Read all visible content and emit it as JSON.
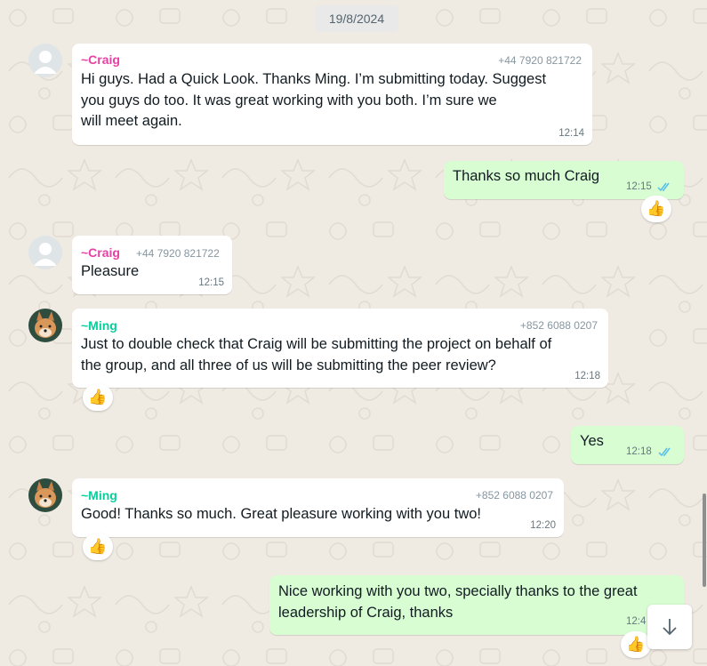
{
  "date_chip": "19/8/2024",
  "colors": {
    "craig_name": "#e542a3",
    "ming_name": "#06cf9c",
    "outgoing_bubble": "#d9fdd3",
    "incoming_bubble": "#ffffff",
    "read_ticks": "#53bdeb"
  },
  "messages": [
    {
      "sender": "~Craig",
      "phone": "+44 7920 821722",
      "text_lines": [
        "Hi guys. Had a Quick Look. Thanks Ming. I’m submitting today. Suggest",
        "you guys do too. It was great working with you both. I’m sure we",
        "will meet again."
      ],
      "time": "12:14"
    },
    {
      "text": "Thanks so much Craig",
      "time": "12:15",
      "reaction": "👍"
    },
    {
      "sender": "~Craig",
      "phone": "+44 7920 821722",
      "text": "Pleasure",
      "time": "12:15"
    },
    {
      "sender": "~Ming",
      "phone": "+852 6088 0207",
      "text_lines": [
        "Just to double check that Craig will be submitting the project on behalf of",
        "the group, and all three of us will be submitting the peer review?"
      ],
      "time": "12:18",
      "reaction": "👍"
    },
    {
      "text": "Yes",
      "time": "12:18"
    },
    {
      "sender": "~Ming",
      "phone": "+852 6088 0207",
      "text": "Good! Thanks so much. Great pleasure working with you two!",
      "time": "12:20",
      "reaction": "👍"
    },
    {
      "text_lines": [
        "Nice working with you two, specially thanks to the great",
        "leadership of Craig, thanks"
      ],
      "time": "12:4",
      "reaction": "👍"
    }
  ],
  "icons": {
    "scroll_down": "arrow-down-icon",
    "default_avatar": "person-icon",
    "ming_avatar": "dog-photo"
  }
}
